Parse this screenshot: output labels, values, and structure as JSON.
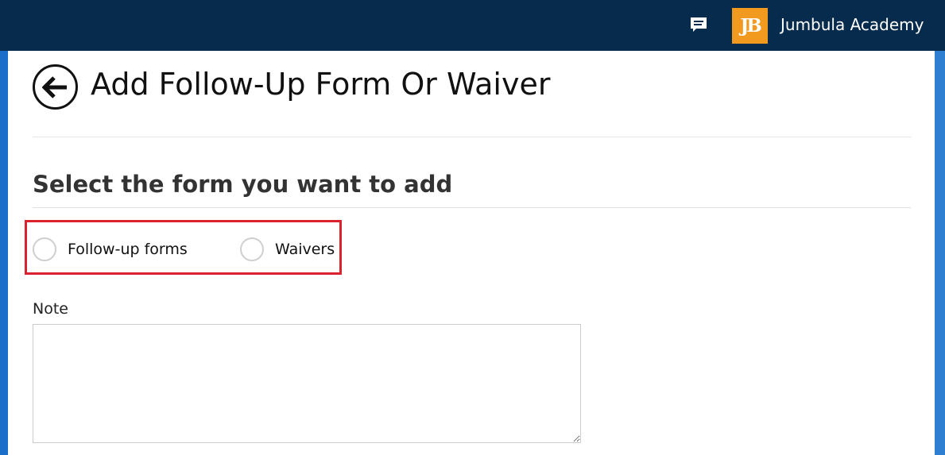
{
  "header": {
    "chat_icon": "chat-bubble-icon",
    "logo_text": "JB",
    "account_name": "Jumbula Academy"
  },
  "page": {
    "back_icon": "arrow-left-circle-icon",
    "title": "Add Follow-Up Form Or Waiver",
    "section_heading": "Select the form you want to add"
  },
  "form_type": {
    "options": [
      {
        "label": "Follow-up forms",
        "selected": false
      },
      {
        "label": "Waivers",
        "selected": false
      }
    ]
  },
  "note": {
    "label": "Note",
    "value": ""
  },
  "colors": {
    "topbar": "#062b4d",
    "frame": "#1b6fc8",
    "logo": "#f19a1f",
    "highlight_border": "#d9232e"
  }
}
